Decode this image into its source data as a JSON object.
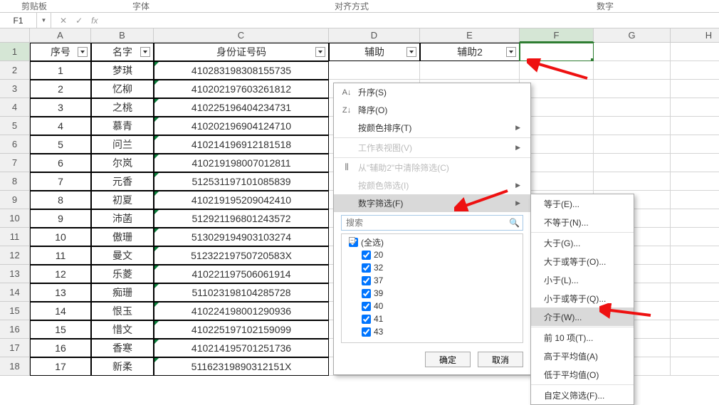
{
  "ribbon": {
    "t1": "剪贴板",
    "t2": "字体",
    "t3": "对齐方式",
    "t4": "数字"
  },
  "nameBox": "F1",
  "fx": {
    "cancel": "✕",
    "enter": "✓",
    "fx": "fx"
  },
  "colLetters": [
    "A",
    "B",
    "C",
    "D",
    "E",
    "F",
    "G",
    "H"
  ],
  "rowNums": [
    "1",
    "2",
    "3",
    "4",
    "5",
    "6",
    "7",
    "8",
    "9",
    "10",
    "11",
    "12",
    "13",
    "14",
    "15",
    "16",
    "17",
    "18"
  ],
  "headerRow": {
    "A": "序号",
    "B": "名字",
    "C": "身份证号码",
    "D": "辅助",
    "E": "辅助2"
  },
  "rows": [
    {
      "A": "1",
      "B": "梦琪",
      "C": "410283198308155735"
    },
    {
      "A": "2",
      "B": "忆柳",
      "C": "410202197603261812"
    },
    {
      "A": "3",
      "B": "之桃",
      "C": "410225196404234731"
    },
    {
      "A": "4",
      "B": "慕青",
      "C": "410202196904124710"
    },
    {
      "A": "5",
      "B": "问兰",
      "C": "410214196912181518"
    },
    {
      "A": "6",
      "B": "尔岚",
      "C": "410219198007012811"
    },
    {
      "A": "7",
      "B": "元香",
      "C": "512531197101085839"
    },
    {
      "A": "8",
      "B": "初夏",
      "C": "410219195209042410"
    },
    {
      "A": "9",
      "B": "沛菡",
      "C": "512921196801243572"
    },
    {
      "A": "10",
      "B": "傲珊",
      "C": "513029194903103274"
    },
    {
      "A": "11",
      "B": "曼文",
      "C": "51232219750720583X"
    },
    {
      "A": "12",
      "B": "乐菱",
      "C": "410221197506061914"
    },
    {
      "A": "13",
      "B": "痴珊",
      "C": "511023198104285728"
    },
    {
      "A": "14",
      "B": "恨玉",
      "C": "410224198001290936"
    },
    {
      "A": "15",
      "B": "惜文",
      "C": "410225197102159099"
    },
    {
      "A": "16",
      "B": "香寒",
      "C": "410214195701251736"
    },
    {
      "A": "17",
      "B": "新柔",
      "C": "51162319890312151X"
    }
  ],
  "filterMenu": {
    "sortAsc": "升序(S)",
    "sortDesc": "降序(O)",
    "sortByColor": "按颜色排序(T)",
    "sheetView": "工作表视图(V)",
    "clearFilter": "从\"辅助2\"中清除筛选(C)",
    "filterByColor": "按颜色筛选(I)",
    "numberFilter": "数字筛选(F)",
    "searchPlaceholder": "搜索",
    "selectAll": "(全选)",
    "options": [
      "20",
      "32",
      "37",
      "39",
      "40",
      "41",
      "43"
    ],
    "ok": "确定",
    "cancel": "取消"
  },
  "numberFilterSub": {
    "eq": "等于(E)...",
    "neq": "不等于(N)...",
    "gt": "大于(G)...",
    "gte": "大于或等于(O)...",
    "lt": "小于(L)...",
    "lte": "小于或等于(Q)...",
    "between": "介于(W)...",
    "top10": "前 10 项(T)...",
    "aboveAvg": "高于平均值(A)",
    "belowAvg": "低于平均值(O)",
    "custom": "自定义筛选(F)..."
  }
}
